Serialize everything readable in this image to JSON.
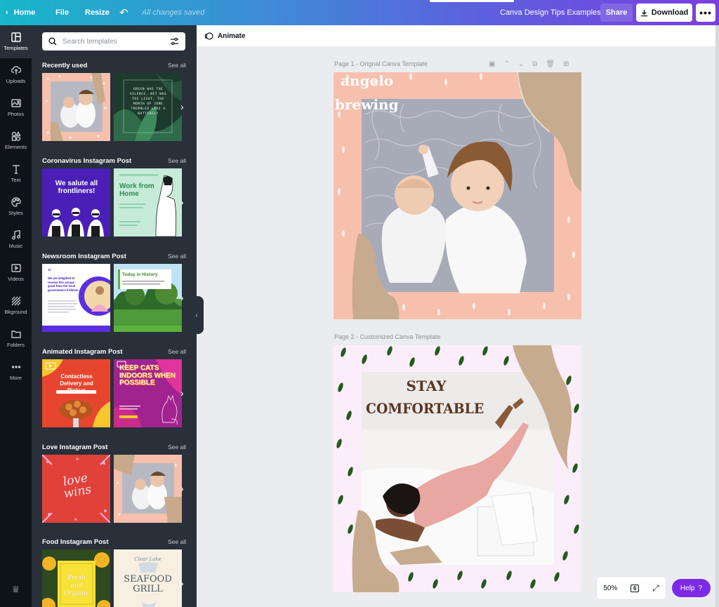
{
  "topbar": {
    "home": "Home",
    "file": "File",
    "resize": "Resize",
    "saved": "All changes saved",
    "title": "Canva Design Tips Examples",
    "share": "Share",
    "download": "Download",
    "more": "•••"
  },
  "rail": [
    {
      "label": "Templates",
      "icon": "templates-icon"
    },
    {
      "label": "Uploads",
      "icon": "uploads-icon"
    },
    {
      "label": "Photos",
      "icon": "photos-icon"
    },
    {
      "label": "Elements",
      "icon": "elements-icon"
    },
    {
      "label": "Text",
      "icon": "text-icon"
    },
    {
      "label": "Styles",
      "icon": "styles-icon"
    },
    {
      "label": "Music",
      "icon": "music-icon"
    },
    {
      "label": "Videos",
      "icon": "videos-icon"
    },
    {
      "label": "Bkground",
      "icon": "background-icon"
    },
    {
      "label": "Folders",
      "icon": "folders-icon"
    },
    {
      "label": "More",
      "icon": "more-icon"
    }
  ],
  "search": {
    "placeholder": "Search templates"
  },
  "sections": [
    {
      "title": "Recently used",
      "see_all": "See all",
      "t1": {},
      "t2": {
        "text": "GREEN WAS THE SILENCE, WET WAS THE LIGHT, THE MONTH OF JUNE TREMBLED LIKE A BUTTERFLY"
      }
    },
    {
      "title": "Coronavirus Instagram Post",
      "see_all": "See all",
      "t1": {
        "text": "We salute all frontliners!"
      },
      "t2": {
        "text": "Work from Home"
      }
    },
    {
      "title": "Newsroom Instagram Post",
      "see_all": "See all",
      "t1": {
        "text": "We are delighted to receive this annual grant from the local government of Illinois."
      },
      "t2": {
        "text": "Today in History"
      }
    },
    {
      "title": "Animated Instagram Post",
      "see_all": "See all",
      "t1": {
        "text": "Contactless Delivery and Pickup"
      },
      "t2": {
        "text": "KEEP CATS INDOORS WHEN POSSIBLE"
      }
    },
    {
      "title": "Love Instagram Post",
      "see_all": "See all",
      "t1": {
        "text": "love wins"
      },
      "t2": {}
    },
    {
      "title": "Food Instagram Post",
      "see_all": "See all",
      "t1": {
        "text": "Fresh and Organic"
      },
      "t2": {
        "text": "SEAFOOD GRILL",
        "sub": "Clear Lake"
      }
    }
  ],
  "canvas": {
    "animate": "Animate",
    "page1_label": "Page 1 - Orignal Canva Template",
    "page1_text": [
      "angelo",
      "brewing"
    ],
    "page2_label": "Page 2 - Customized Canva Template",
    "page2_text": [
      "STAY",
      "COMFORTABLE"
    ]
  },
  "zoom": {
    "value": "50%",
    "pages": "6"
  },
  "help": {
    "label": "Help",
    "icon": "?"
  }
}
